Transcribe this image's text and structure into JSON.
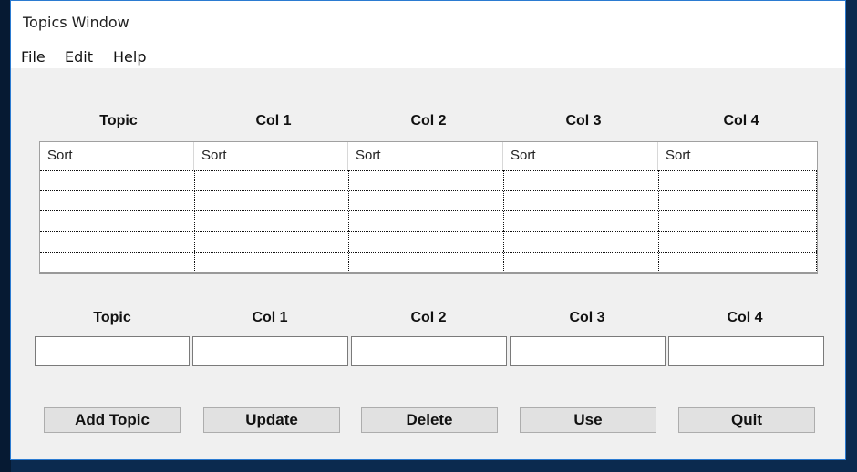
{
  "window": {
    "title": "Topics Window"
  },
  "menubar": {
    "items": [
      "File",
      "Edit",
      "Help"
    ]
  },
  "grid": {
    "headers": [
      "Topic",
      "Col 1",
      "Col 2",
      "Col 3",
      "Col 4"
    ],
    "sort_labels": [
      "Sort",
      "Sort",
      "Sort",
      "Sort",
      "Sort"
    ],
    "rows": [
      [
        "",
        "",
        "",
        "",
        ""
      ],
      [
        "",
        "",
        "",
        "",
        ""
      ],
      [
        "",
        "",
        "",
        "",
        ""
      ],
      [
        "",
        "",
        "",
        "",
        ""
      ],
      [
        "",
        "",
        "",
        "",
        ""
      ]
    ]
  },
  "form": {
    "labels": [
      "Topic",
      "Col 1",
      "Col 2",
      "Col 3",
      "Col 4"
    ],
    "values": [
      "",
      "",
      "",
      "",
      ""
    ]
  },
  "buttons": {
    "add_topic": "Add Topic",
    "update": "Update",
    "delete": "Delete",
    "use": "Use",
    "quit": "Quit"
  },
  "colors": {
    "window_bg": "#f0f0f0",
    "accent_border": "#2b7bd1",
    "button_bg": "#e1e1e1"
  }
}
